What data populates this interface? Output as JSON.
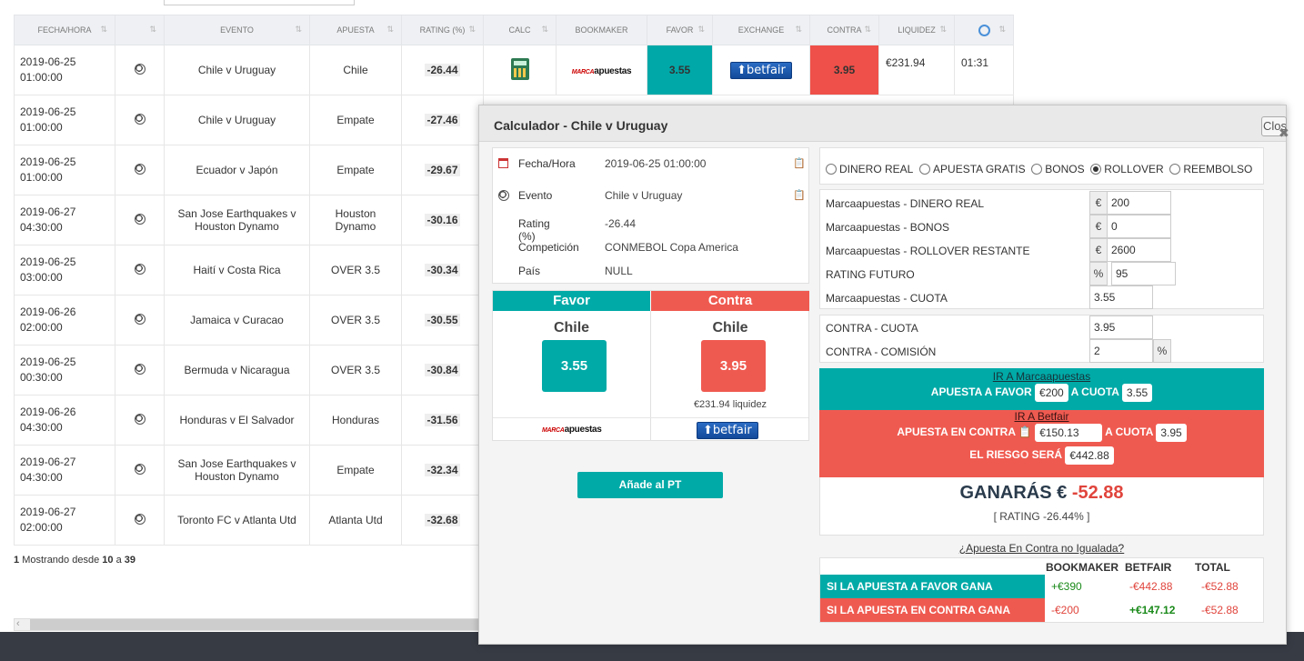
{
  "table": {
    "headers": {
      "fecha": "FECHA/HORA",
      "evento": "EVENTO",
      "apuesta": "APUESTA",
      "rating": "RATING (%)",
      "calc": "CALC",
      "bookmaker": "BOOKMAKER",
      "favor": "FAVOR",
      "exchange": "EXCHANGE",
      "contra": "CONTRA",
      "liquidez": "LIQUIDEZ"
    },
    "rows": [
      {
        "date": "2019-06-25",
        "time": "01:00:00",
        "event": "Chile v Uruguay",
        "bet": "Chile",
        "rating": "-26.44",
        "favor": "3.55",
        "contra": "3.95",
        "liquidez": "€231.94",
        "clock": "01:31"
      },
      {
        "date": "2019-06-25",
        "time": "01:00:00",
        "event": "Chile v Uruguay",
        "bet": "Empate",
        "rating": "-27.46"
      },
      {
        "date": "2019-06-25",
        "time": "01:00:00",
        "event": "Ecuador v Japón",
        "bet": "Empate",
        "rating": "-29.67"
      },
      {
        "date": "2019-06-27",
        "time": "04:30:00",
        "event": "San Jose Earthquakes v Houston Dynamo",
        "bet": "Houston Dynamo",
        "rating": "-30.16"
      },
      {
        "date": "2019-06-25",
        "time": "03:00:00",
        "event": "Haití v Costa Rica",
        "bet": "OVER 3.5",
        "rating": "-30.34"
      },
      {
        "date": "2019-06-26",
        "time": "02:00:00",
        "event": "Jamaica v Curacao",
        "bet": "OVER 3.5",
        "rating": "-30.55"
      },
      {
        "date": "2019-06-25",
        "time": "00:30:00",
        "event": "Bermuda v Nicaragua",
        "bet": "OVER 3.5",
        "rating": "-30.84"
      },
      {
        "date": "2019-06-26",
        "time": "04:30:00",
        "event": "Honduras v El Salvador",
        "bet": "Honduras",
        "rating": "-31.56"
      },
      {
        "date": "2019-06-27",
        "time": "04:30:00",
        "event": "San Jose Earthquakes v Houston Dynamo",
        "bet": "Empate",
        "rating": "-32.34"
      },
      {
        "date": "2019-06-27",
        "time": "02:00:00",
        "event": "Toronto FC v Atlanta Utd",
        "bet": "Atlanta Utd",
        "rating": "-32.68"
      }
    ],
    "bookmaker_logo": {
      "prefix": "MARCA",
      "suffix": "apuestas"
    },
    "exchange_logo": "betfair"
  },
  "footer": {
    "page": "1",
    "text1": "Mostrando desde",
    "from": "10",
    "text2": "a",
    "to": "39"
  },
  "modal": {
    "title": "Calculador - Chile v Uruguay",
    "close_label": "Close",
    "info": {
      "fecha_label": "Fecha/Hora",
      "fecha": "2019-06-25 01:00:00",
      "evento_label": "Evento",
      "evento": "Chile v Uruguay",
      "rating_label": "Rating (%)",
      "rating": "-26.44",
      "competicion_label": "Competición",
      "competicion": "CONMEBOL Copa America",
      "pais_label": "País",
      "pais": "NULL"
    },
    "favor_header": "Favor",
    "contra_header": "Contra",
    "favor_team": "Chile",
    "contra_team": "Chile",
    "favor_odds": "3.55",
    "contra_odds": "3.95",
    "liquidez": "€231.94 liquidez",
    "add_button": "Añade al PT",
    "modes": [
      "DINERO REAL",
      "APUESTA GRATIS",
      "BONOS",
      "ROLLOVER",
      "REEMBOLSO"
    ],
    "selected_mode": "ROLLOVER",
    "fields": {
      "dinero_label": "Marcaapuestas - DINERO REAL",
      "dinero_unit": "€",
      "dinero": "200",
      "bonos_label": "Marcaapuestas - BONOS",
      "bonos_unit": "€",
      "bonos": "0",
      "rollover_label": "Marcaapuestas - ROLLOVER RESTANTE",
      "rollover_unit": "€",
      "rollover": "2600",
      "rating_label": "RATING FUTURO",
      "rating_unit": "%",
      "rating": "95",
      "cuota_label": "Marcaapuestas - CUOTA",
      "cuota": "3.55",
      "contra_cuota_label": "CONTRA - CUOTA",
      "contra_cuota": "3.95",
      "comision_label": "CONTRA - COMISIÓN",
      "comision": "2",
      "comision_unit": "%"
    },
    "result": {
      "ir_marca": "IR A Marcaapuestas",
      "apuesta_favor": "APUESTA A FAVOR",
      "favor_amount": "€200",
      "a_cuota": "A CUOTA",
      "favor_cuota": "3.55",
      "ir_betfair": "IR A Betfair",
      "apuesta_contra": "APUESTA EN CONTRA",
      "contra_amount": "€150.13",
      "contra_cuota": "3.95",
      "riesgo": "EL RIESGO SERÁ",
      "riesgo_amount": "€442.88",
      "ganaras": "GANARÁS €",
      "ganaras_value": "-52.88",
      "rating_line": "[ RATING -26.44% ]"
    },
    "summary": {
      "link": "¿Apuesta En Contra no Igualada?",
      "headers": [
        "BOOKMAKER",
        "BETFAIR",
        "TOTAL"
      ],
      "rows": [
        {
          "label": "SI LA APUESTA A FAVOR GANA",
          "bookmaker": "+€390",
          "betfair": "-€442.88",
          "total": "-€52.88"
        },
        {
          "label": "SI LA APUESTA EN CONTRA GANA",
          "bookmaker": "-€200",
          "betfair": "+€147.12",
          "total": "-€52.88"
        }
      ]
    }
  },
  "colors": {
    "teal": "#00aaa7",
    "red": "#ef5a50",
    "dark": "#373b44"
  }
}
